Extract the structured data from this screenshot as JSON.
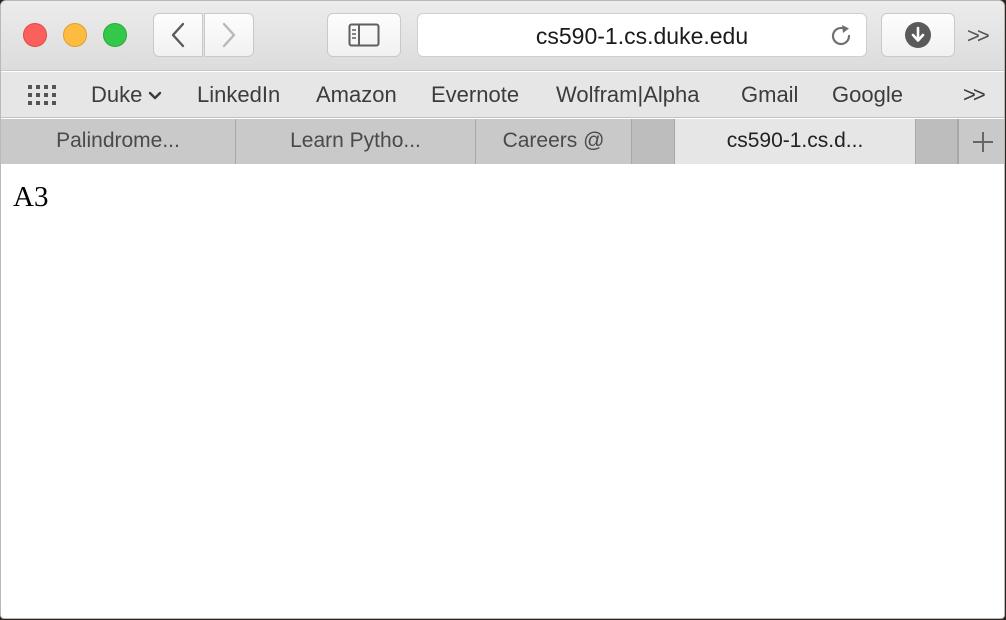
{
  "toolbar": {
    "url": "cs590-1.cs.duke.edu",
    "overflow": ">>"
  },
  "bookmarks": {
    "items": [
      {
        "label": "Duke",
        "has_dropdown": true
      },
      {
        "label": "LinkedIn"
      },
      {
        "label": "Amazon"
      },
      {
        "label": "Evernote"
      },
      {
        "label": "Wolfram|Alpha"
      },
      {
        "label": "Gmail"
      },
      {
        "label": "Google"
      }
    ],
    "overflow": ">>"
  },
  "tabs": [
    {
      "label": "Palindrome..."
    },
    {
      "label": "Learn Pytho..."
    },
    {
      "label": "Careers @"
    },
    {
      "label": "cs590-1.cs.d...",
      "active": true
    }
  ],
  "page": {
    "text": "A3"
  },
  "colors": {
    "close": "#fc605c",
    "minimize": "#fdbc40",
    "maximize": "#34c84a"
  }
}
